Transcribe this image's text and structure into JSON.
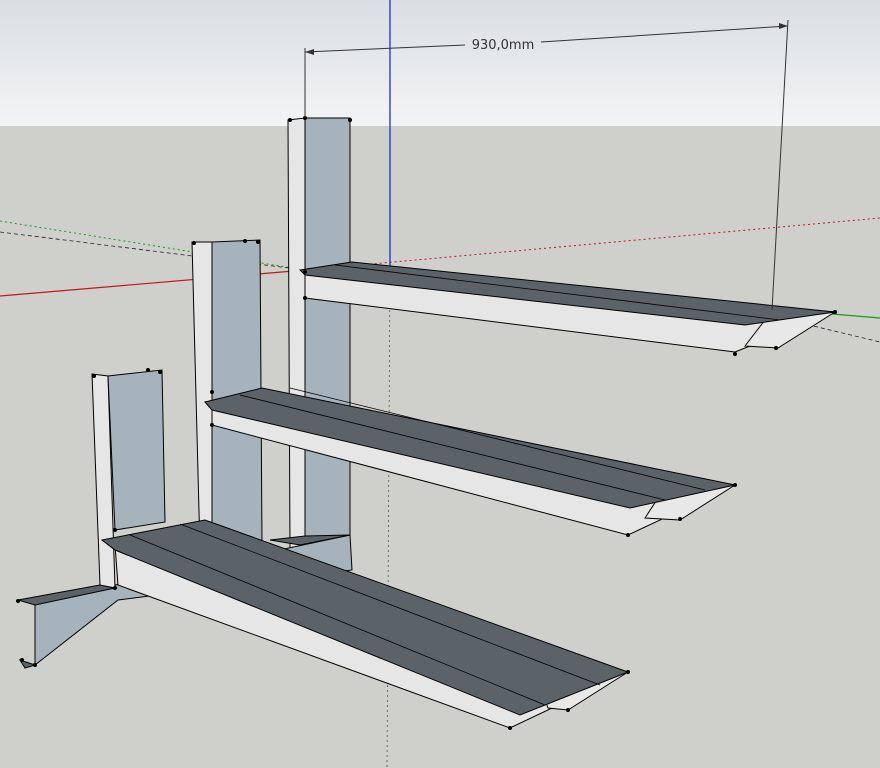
{
  "viewport": {
    "sky_top_color": "#d9dee2",
    "sky_bottom_color": "#f3f4f5",
    "ground_color": "#cfcfcb",
    "axis_red": "#c01818",
    "axis_green": "#1a9a1a",
    "axis_blue": "#1a1ad0"
  },
  "materials": {
    "light_face": "#e6e6e6",
    "blue_face": "#a6b3bd",
    "dark_face": "#5b6268",
    "edge": "#000000"
  },
  "dimension": {
    "label": "930,0mm"
  }
}
